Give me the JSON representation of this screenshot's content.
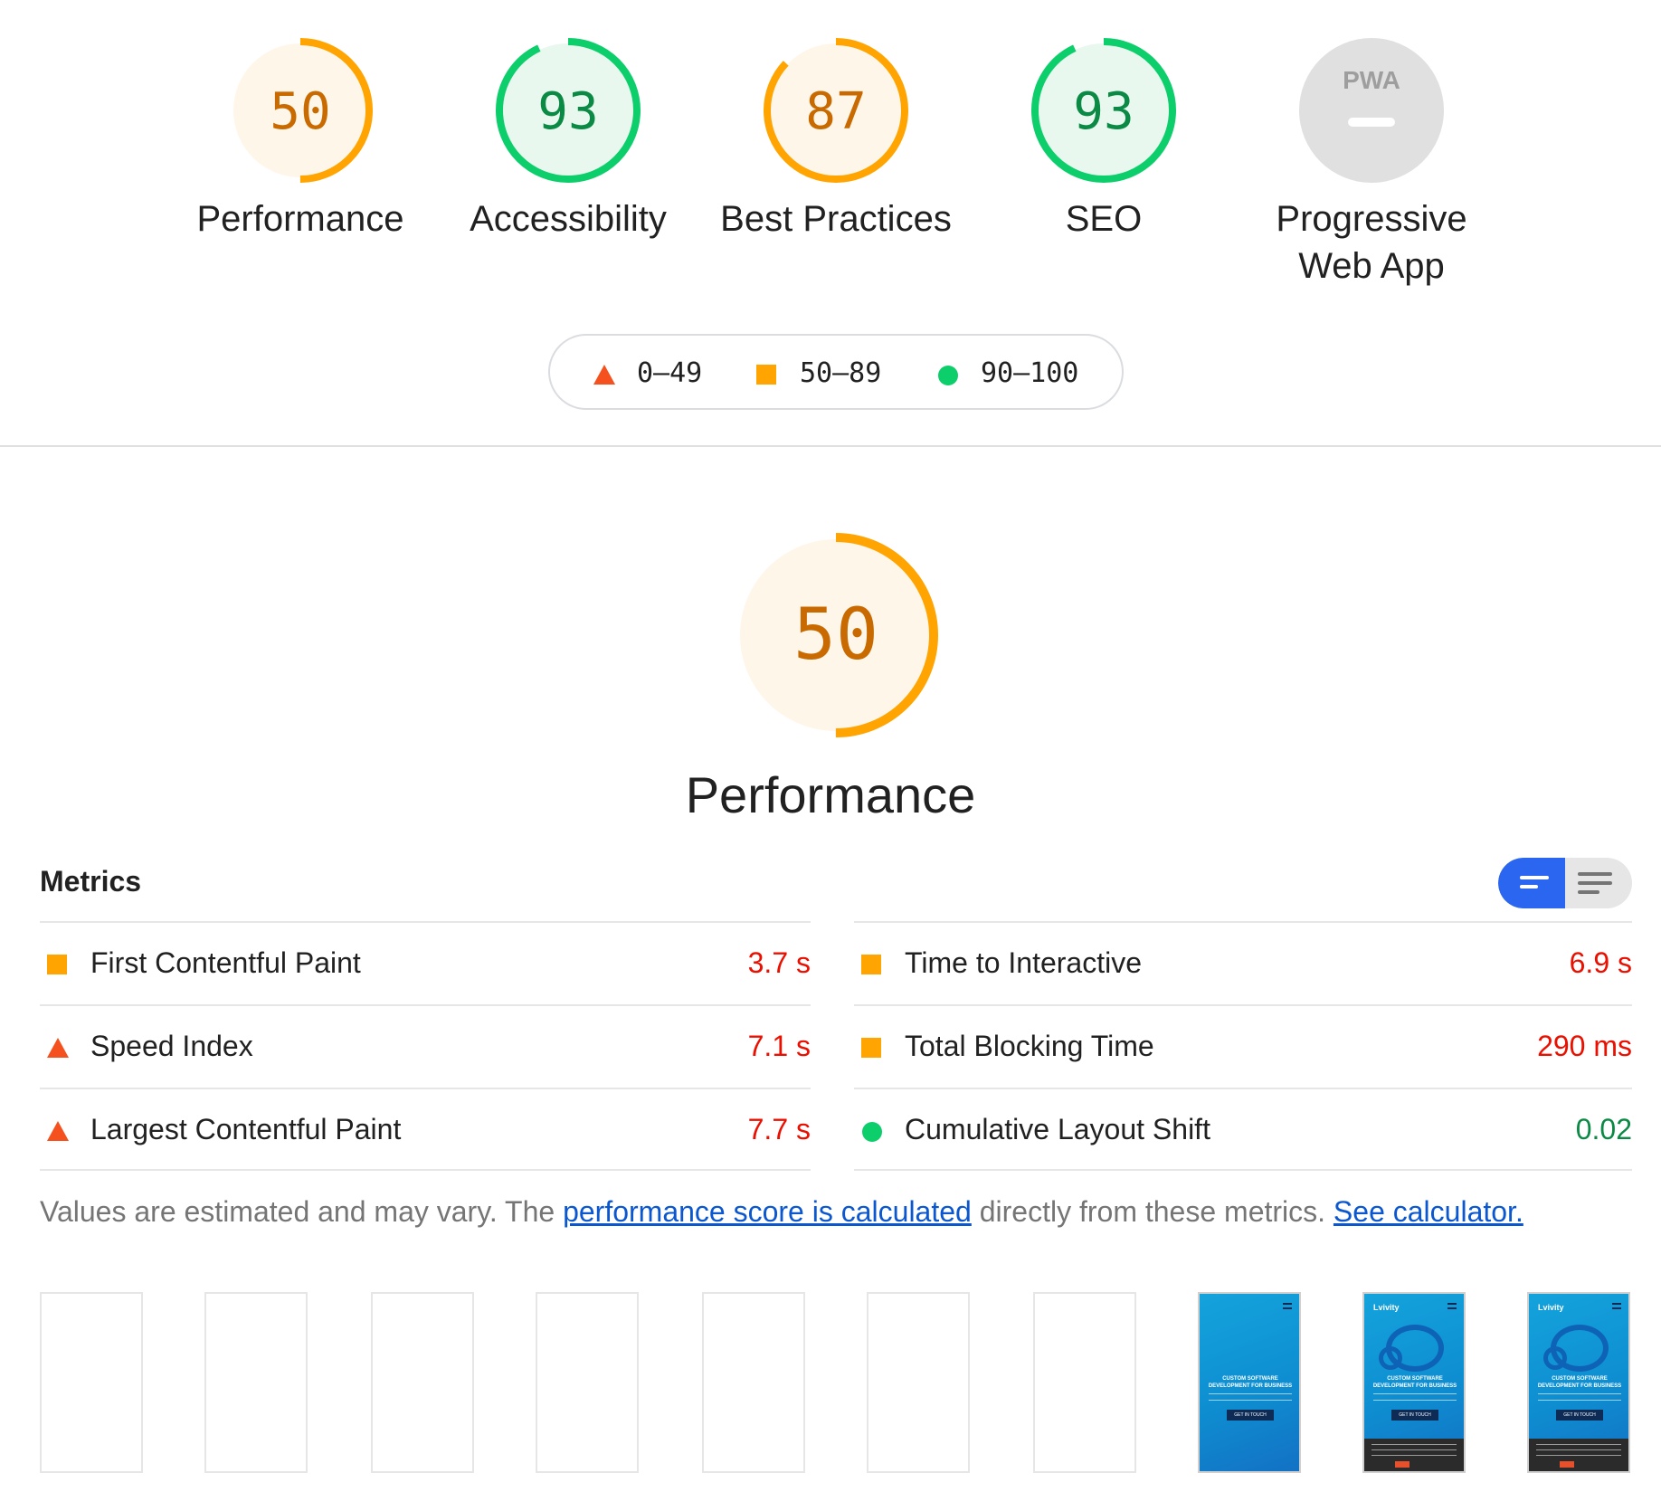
{
  "categories": [
    {
      "label": "Performance",
      "score": "50",
      "score_value": 50,
      "rating": "average"
    },
    {
      "label": "Accessibility",
      "score": "93",
      "score_value": 93,
      "rating": "pass"
    },
    {
      "label": "Best Practices",
      "score": "87",
      "score_value": 87,
      "rating": "average"
    },
    {
      "label": "SEO",
      "score": "93",
      "score_value": 93,
      "rating": "pass"
    },
    {
      "label_line1": "Progressive",
      "label_line2": "Web App",
      "badge": "PWA",
      "rating": "na"
    }
  ],
  "legend": [
    {
      "range": "0–49",
      "shape": "triangle",
      "color": "#f4511e"
    },
    {
      "range": "50–89",
      "shape": "square",
      "color": "#ffa400"
    },
    {
      "range": "90–100",
      "shape": "circle",
      "color": "#0cce6b"
    }
  ],
  "colors": {
    "fail": "#f4511e",
    "average": "#ffa400",
    "average_bg": "#fff6ea",
    "pass": "#0cce6b",
    "pass_bg": "#e8f8ee",
    "pass_text": "#0a8a44",
    "fail_text": "#eb0f00",
    "na": "#e0e0e0",
    "link": "#0b57d0",
    "toggle_on": "#2a66f0"
  },
  "performance": {
    "score": "50",
    "score_value": 50,
    "title": "Performance"
  },
  "metrics": {
    "heading": "Metrics",
    "left": [
      {
        "label": "First Contentful Paint",
        "value": "3.7 s",
        "rating": "average"
      },
      {
        "label": "Speed Index",
        "value": "7.1 s",
        "rating": "fail"
      },
      {
        "label": "Largest Contentful Paint",
        "value": "7.7 s",
        "rating": "fail"
      }
    ],
    "right": [
      {
        "label": "Time to Interactive",
        "value": "6.9 s",
        "rating": "average"
      },
      {
        "label": "Total Blocking Time",
        "value": "290 ms",
        "rating": "average"
      },
      {
        "label": "Cumulative Layout Shift",
        "value": "0.02",
        "rating": "pass"
      }
    ]
  },
  "note": {
    "prefix": "Values are estimated and may vary. The ",
    "link1": "performance score is calculated",
    "middle": " directly from these metrics. ",
    "link2": "See calculator."
  },
  "filmstrip": {
    "frames": [
      "blank",
      "blank",
      "blank",
      "blank",
      "blank",
      "blank",
      "blank",
      "hero",
      "full",
      "full"
    ],
    "logo": "Lvivity",
    "headline": "CUSTOM SOFTWARE DEVELOPMENT FOR BUSINESS",
    "button": "GET IN TOUCH"
  }
}
